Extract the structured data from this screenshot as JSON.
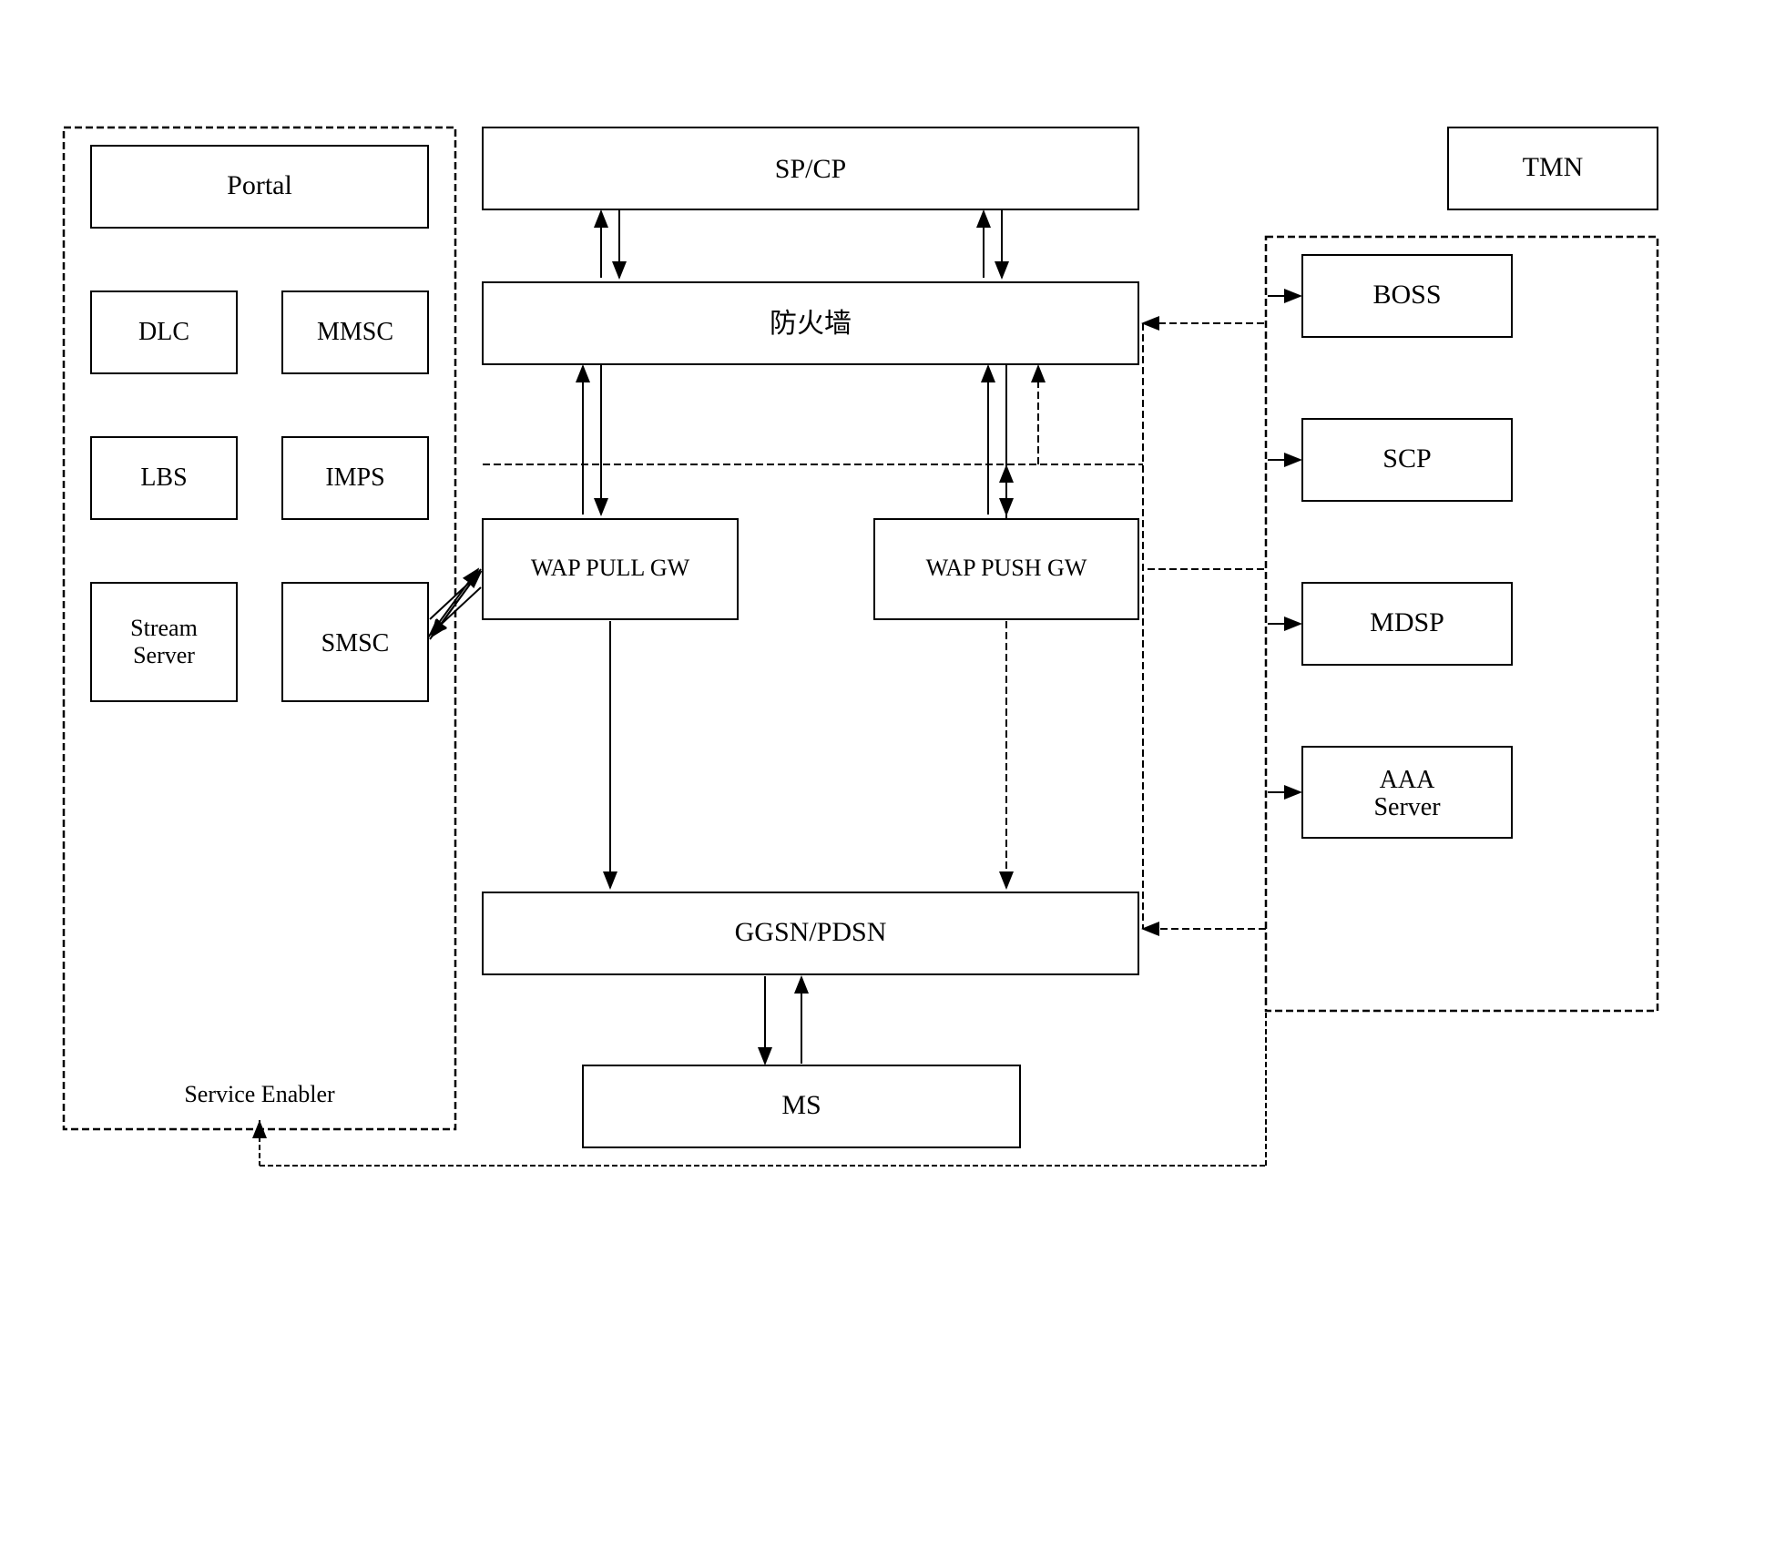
{
  "boxes": {
    "portal": {
      "label": "Portal"
    },
    "dlc": {
      "label": "DLC"
    },
    "mmsc": {
      "label": "MMSC"
    },
    "lbs": {
      "label": "LBS"
    },
    "imps": {
      "label": "IMPS"
    },
    "stream_server": {
      "label": "Stream\nServer"
    },
    "smsc": {
      "label": "SMSC"
    },
    "service_enabler_label": {
      "label": "Service Enabler"
    },
    "spcp": {
      "label": "SP/CP"
    },
    "firewall": {
      "label": "防火墙"
    },
    "wap_pull": {
      "label": "WAP PULL GW"
    },
    "wap_push": {
      "label": "WAP PUSH GW"
    },
    "ggsn": {
      "label": "GGSN/PDSN"
    },
    "ms": {
      "label": "MS"
    },
    "tmn": {
      "label": "TMN"
    },
    "boss": {
      "label": "BOSS"
    },
    "scp": {
      "label": "SCP"
    },
    "mdsp": {
      "label": "MDSP"
    },
    "aaa": {
      "label": "AAA\nServer"
    }
  }
}
